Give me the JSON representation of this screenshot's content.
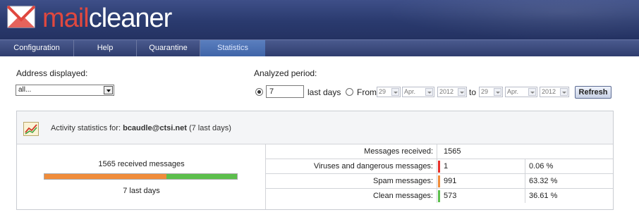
{
  "app": {
    "logo_part1": "mail",
    "logo_part2": "cleaner"
  },
  "nav": {
    "items": [
      {
        "label": "Configuration"
      },
      {
        "label": "Help"
      },
      {
        "label": "Quarantine"
      },
      {
        "label": "Statistics",
        "active": true
      }
    ]
  },
  "address": {
    "label": "Address displayed:",
    "selected": "all..."
  },
  "period": {
    "label": "Analyzed period:",
    "days_value": "7",
    "last_days_label": "last days",
    "from_label": "From",
    "to_label": "to",
    "from": {
      "day": "29",
      "month": "Apr.",
      "year": "2012"
    },
    "to": {
      "day": "29",
      "month": "Apr.",
      "year": "2012"
    },
    "refresh_label": "Refresh"
  },
  "panel": {
    "title_prefix": "Activity statistics for:",
    "address": "bcaudle@ctsi.net",
    "title_suffix": "(7 last days)",
    "received_summary": "1565 received messages",
    "period_text": "7 last days",
    "bar": [
      {
        "name": "viruses",
        "color": "#e8302a",
        "fraction": 0.0006
      },
      {
        "name": "spam",
        "color": "#f08c3a",
        "fraction": 0.6332
      },
      {
        "name": "clean",
        "color": "#5cbf4c",
        "fraction": 0.3661
      }
    ]
  },
  "stats": {
    "rows": [
      {
        "label": "Messages received:",
        "count": "1565",
        "percent": "",
        "color": ""
      },
      {
        "label": "Viruses and dangerous messages:",
        "count": "1",
        "percent": "0.06 %",
        "color": "#e8302a"
      },
      {
        "label": "Spam messages:",
        "count": "991",
        "percent": "63.32 %",
        "color": "#f08c3a"
      },
      {
        "label": "Clean messages:",
        "count": "573",
        "percent": "36.61 %",
        "color": "#5cbf4c"
      }
    ]
  }
}
